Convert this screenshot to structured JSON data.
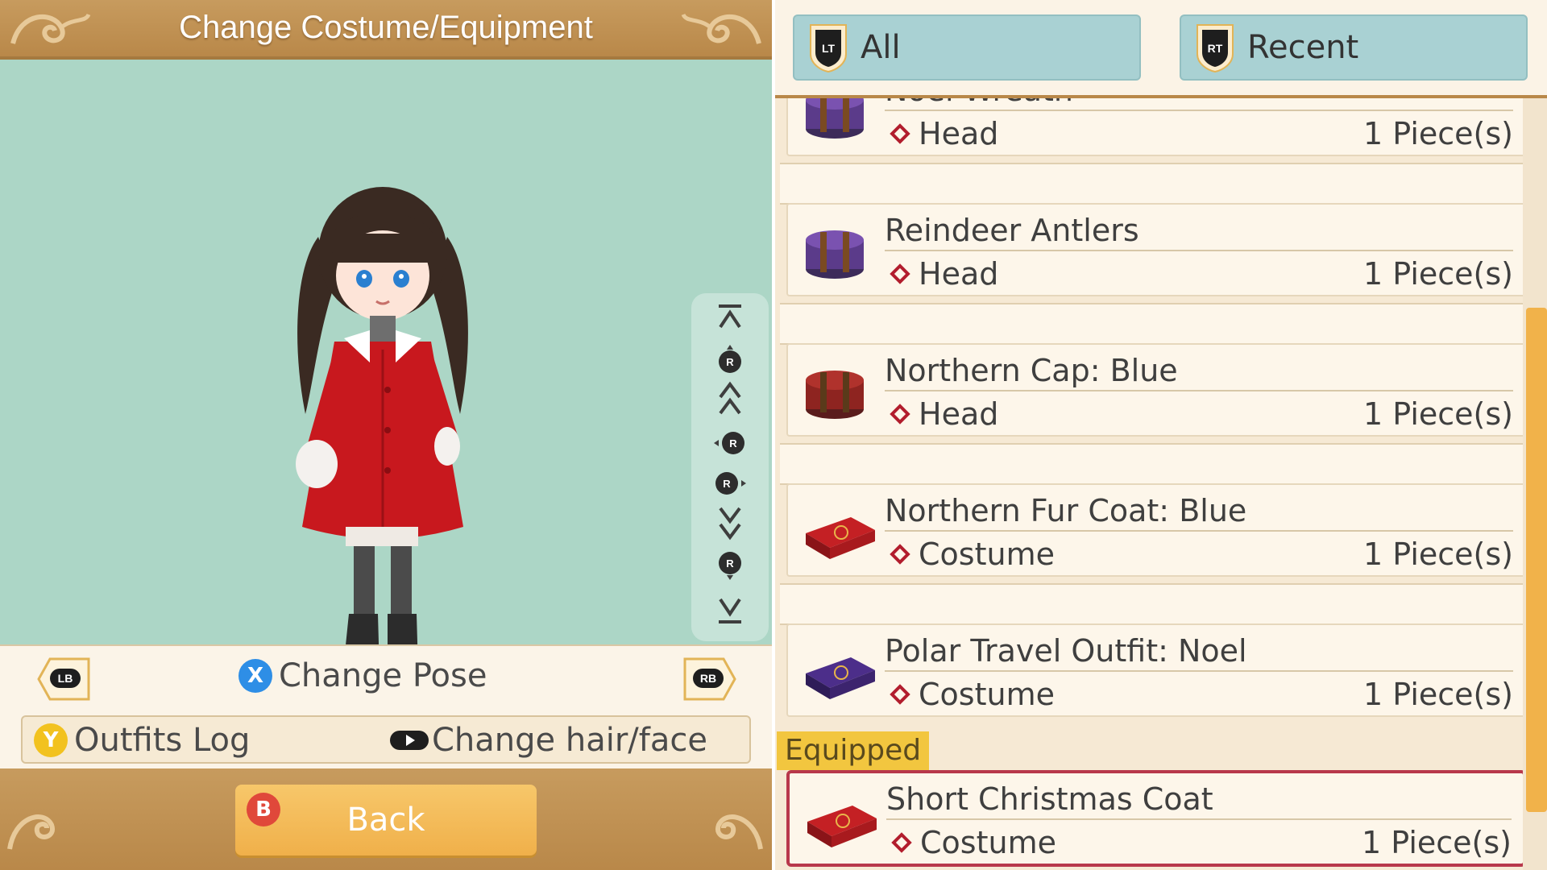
{
  "header": {
    "title": "Change Costume/Equipment"
  },
  "preview_controls": {
    "shoulder_left": "LB",
    "shoulder_right": "RB",
    "change_pose": {
      "button": "X",
      "label": "Change Pose"
    },
    "outfits_log": {
      "button": "Y",
      "label": "Outfits Log"
    },
    "change_hair_face": {
      "label": "Change hair/face"
    },
    "camera_stick": "R"
  },
  "back": {
    "button": "B",
    "label": "Back"
  },
  "tabs": [
    {
      "trigger": "LT",
      "label": "All"
    },
    {
      "trigger": "RT",
      "label": "Recent"
    }
  ],
  "items": [
    {
      "name": "Noel Wreath",
      "category": "Head",
      "quantity": "1 Piece(s)",
      "icon": "hat-box-purple-icon"
    },
    {
      "name": "Reindeer Antlers",
      "category": "Head",
      "quantity": "1 Piece(s)",
      "icon": "hat-box-purple-icon"
    },
    {
      "name": "Northern Cap: Blue",
      "category": "Head",
      "quantity": "1 Piece(s)",
      "icon": "hat-box-red-icon"
    },
    {
      "name": "Northern Fur Coat: Blue",
      "category": "Costume",
      "quantity": "1 Piece(s)",
      "icon": "costume-case-red-icon"
    },
    {
      "name": "Polar Travel Outfit: Noel",
      "category": "Costume",
      "quantity": "1 Piece(s)",
      "icon": "costume-case-purple-icon"
    }
  ],
  "equipped": {
    "label": "Equipped",
    "item": {
      "name": "Short Christmas Coat",
      "category": "Costume",
      "quantity": "1 Piece(s)",
      "icon": "costume-case-red-icon"
    }
  },
  "colors": {
    "accent_gold": "#b98849",
    "preview_bg": "#acd6c6",
    "tab_bg": "#a9d1d3",
    "back_button": "#f0b04a",
    "equipped_border": "#b8384b",
    "scrollbar": "#f1b24a"
  }
}
